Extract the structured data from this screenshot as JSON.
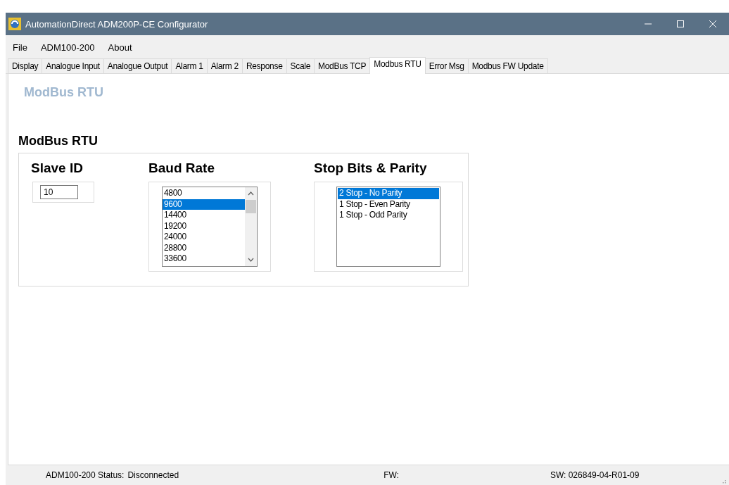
{
  "window": {
    "title": "AutomationDirect ADM200P-CE Configurator"
  },
  "menu": [
    "File",
    "ADM100-200",
    "About"
  ],
  "tabs": [
    {
      "label": "Display",
      "selected": false
    },
    {
      "label": "Analogue Input",
      "selected": false
    },
    {
      "label": "Analogue Output",
      "selected": false
    },
    {
      "label": "Alarm 1",
      "selected": false
    },
    {
      "label": "Alarm 2",
      "selected": false
    },
    {
      "label": "Response",
      "selected": false
    },
    {
      "label": "Scale",
      "selected": false
    },
    {
      "label": "ModBus TCP",
      "selected": false
    },
    {
      "label": "Modbus RTU",
      "selected": true
    },
    {
      "label": "Error Msg",
      "selected": false
    },
    {
      "label": "Modbus FW Update",
      "selected": false
    }
  ],
  "page_title": "ModBus RTU",
  "section_title": "ModBus RTU",
  "slave_id": {
    "label": "Slave ID",
    "value": "10"
  },
  "baud_rate": {
    "label": "Baud Rate",
    "items": [
      {
        "label": "4800",
        "selected": false
      },
      {
        "label": "9600",
        "selected": true
      },
      {
        "label": "14400",
        "selected": false
      },
      {
        "label": "19200",
        "selected": false
      },
      {
        "label": "24000",
        "selected": false
      },
      {
        "label": "28800",
        "selected": false
      },
      {
        "label": "33600",
        "selected": false
      }
    ]
  },
  "stop_bits_parity": {
    "label": "Stop Bits & Parity",
    "items": [
      {
        "label": "2 Stop - No Parity",
        "selected": true
      },
      {
        "label": "1 Stop - Even Parity",
        "selected": false
      },
      {
        "label": "1 Stop - Odd Parity",
        "selected": false
      }
    ]
  },
  "status_bar": {
    "status_label": "ADM100-200 Status:",
    "status_value": "Disconnected",
    "fw": "FW:",
    "sw": "SW: 026849-04-R01-09"
  }
}
